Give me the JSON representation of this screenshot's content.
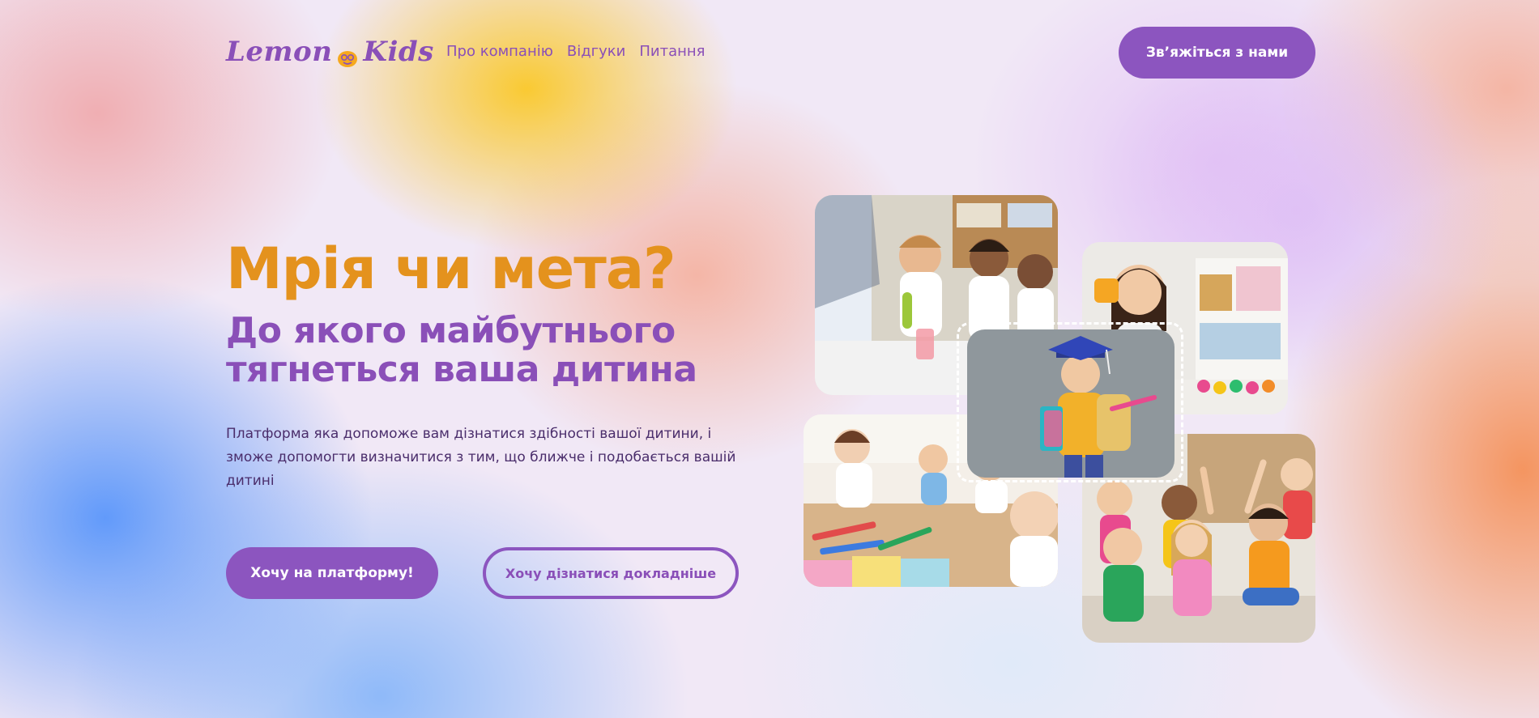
{
  "header": {
    "logo": {
      "text_left": "Lemon",
      "text_right": "Kids",
      "icon": "lemon-face-icon"
    },
    "nav": [
      {
        "label": "Про компанію"
      },
      {
        "label": "Відгуки"
      },
      {
        "label": "Питання"
      }
    ],
    "contact_label": "Зв’яжіться з нами"
  },
  "hero": {
    "title": "Мрія чи мета?",
    "subtitle": "До якого майбутнього тягнеться ваша дитина",
    "description": "Платформа яка допоможе вам дізнатися здібності вашої дитини, і зможе допомогти визначитися з тим, що ближче і подобається вашій дитині",
    "primary_cta": "Хочу на платформу!",
    "secondary_cta": "Хочу дізнатися докладніше"
  },
  "colors": {
    "brand_purple": "#8c55bf",
    "accent_orange": "#e4921d",
    "text_dark": "#4a2d6b"
  },
  "gallery": [
    {
      "name": "science-class-photo"
    },
    {
      "name": "girl-with-toys-photo"
    },
    {
      "name": "drawing-class-photo"
    },
    {
      "name": "kids-raising-hands-photo"
    },
    {
      "name": "graduate-kid-photo"
    }
  ]
}
